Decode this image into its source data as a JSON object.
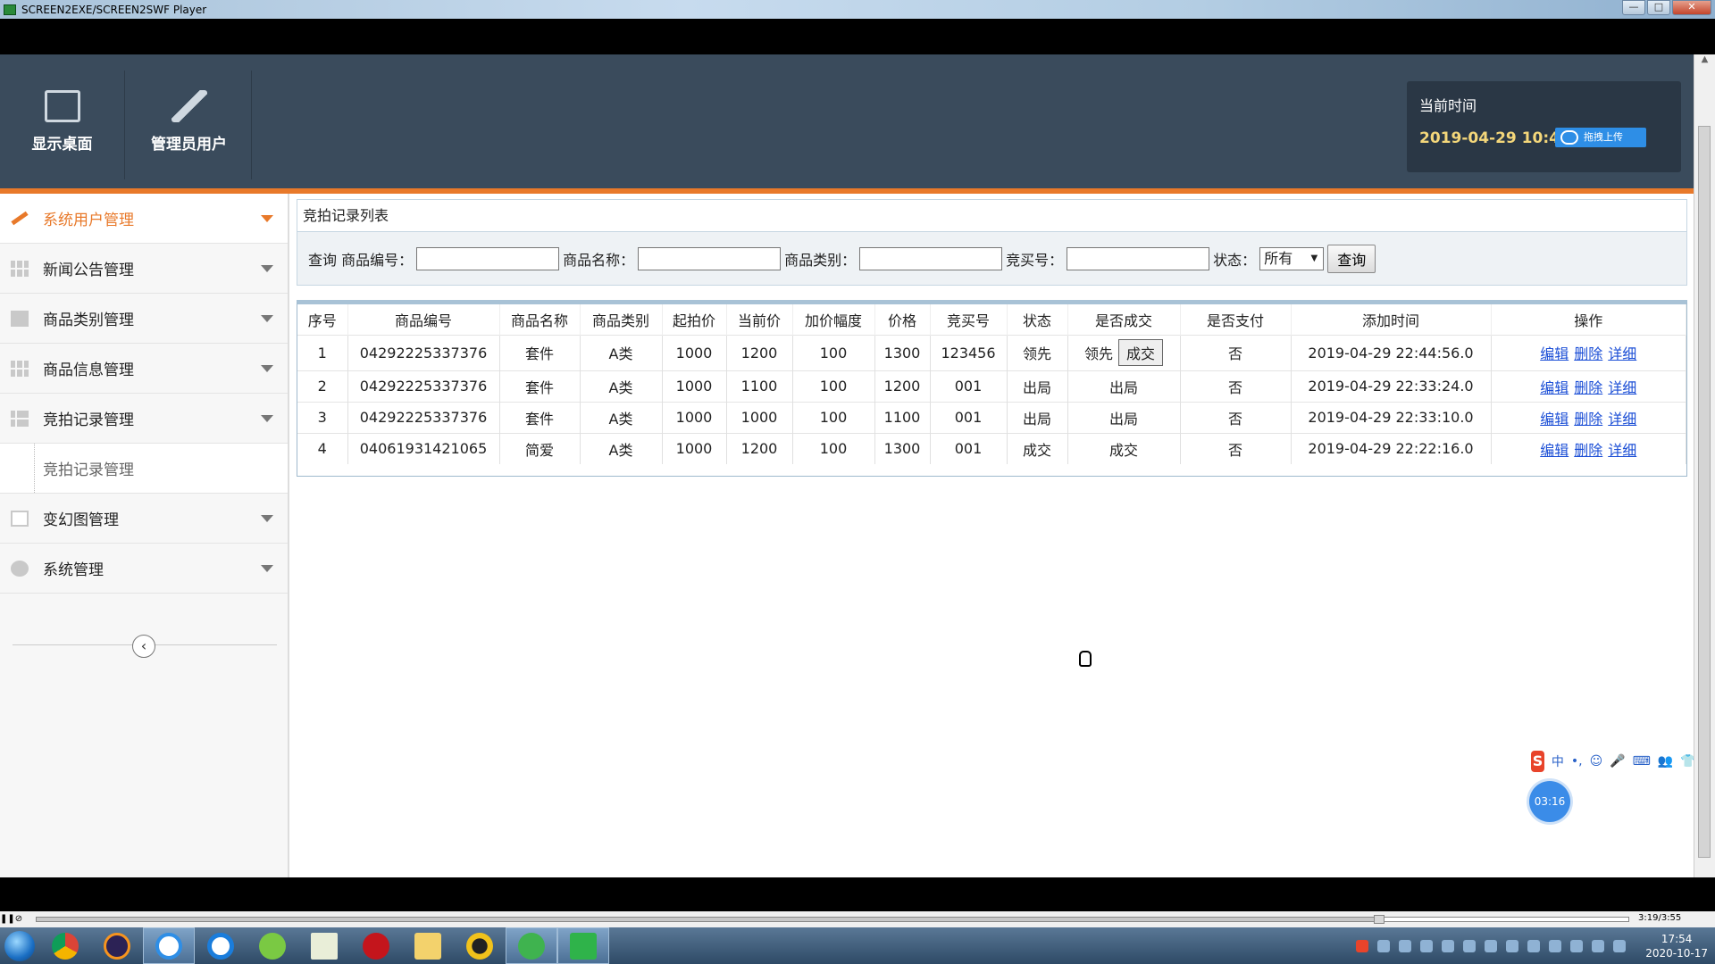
{
  "window": {
    "title": "SCREEN2EXE/SCREEN2SWF Player"
  },
  "header": {
    "items": [
      {
        "label": "显示桌面",
        "icon": "monitor-icon"
      },
      {
        "label": "管理员用户",
        "icon": "pencil-icon"
      }
    ],
    "time_label": "当前时间",
    "time_value": "2019-04-29 10:47:4",
    "upload_label": "拖拽上传"
  },
  "sidebar": {
    "items": [
      {
        "label": "系统用户管理",
        "icon": "pencil-icon"
      },
      {
        "label": "新闻公告管理",
        "icon": "grid-icon"
      },
      {
        "label": "商品类别管理",
        "icon": "image-icon"
      },
      {
        "label": "商品信息管理",
        "icon": "grid-icon"
      },
      {
        "label": "竞拍记录管理",
        "icon": "layout-icon"
      },
      {
        "label": "竞拍记录管理",
        "icon": "none"
      },
      {
        "label": "变幻图管理",
        "icon": "calendar-icon"
      },
      {
        "label": "系统管理",
        "icon": "recycle-icon"
      }
    ],
    "collapse_glyph": "‹"
  },
  "panel": {
    "title": "竞拍记录列表"
  },
  "filter": {
    "query_prefix": "查询",
    "fields": [
      "商品编号：",
      "商品名称：",
      "商品类别：",
      "竞买号："
    ],
    "status_label": "状态：",
    "status_value": "所有",
    "submit": "查询"
  },
  "table": {
    "headers": [
      "序号",
      "商品编号",
      "商品名称",
      "商品类别",
      "起拍价",
      "当前价",
      "加价幅度",
      "价格",
      "竞买号",
      "状态",
      "是否成交",
      "是否支付",
      "添加时间",
      "操作"
    ],
    "rows": [
      [
        "1",
        "04292225337376",
        "套件",
        "A类",
        "1000",
        "1200",
        "100",
        "1300",
        "123456",
        "领先",
        "领先",
        "否",
        "2019-04-29 22:44:56.0"
      ],
      [
        "2",
        "04292225337376",
        "套件",
        "A类",
        "1000",
        "1100",
        "100",
        "1200",
        "001",
        "出局",
        "出局",
        "否",
        "2019-04-29 22:33:24.0"
      ],
      [
        "3",
        "04292225337376",
        "套件",
        "A类",
        "1000",
        "1000",
        "100",
        "1100",
        "001",
        "出局",
        "出局",
        "否",
        "2019-04-29 22:33:10.0"
      ],
      [
        "4",
        "04061931421065",
        "简爱",
        "A类",
        "1000",
        "1200",
        "100",
        "1300",
        "001",
        "成交",
        "成交",
        "否",
        "2019-04-29 22:22:16.0"
      ]
    ],
    "deal_button": "成交",
    "actions": [
      "编辑",
      "删除",
      "详细"
    ]
  },
  "overlay": {
    "ime": [
      "中",
      "•,",
      "☺",
      "🎤",
      "⌨",
      "👥",
      "👕",
      "▦"
    ],
    "timer": "03:16"
  },
  "player": {
    "time": "3:19/3:55"
  },
  "taskbar": {
    "clock_time": "17:54",
    "clock_date": "2020-10-17"
  }
}
